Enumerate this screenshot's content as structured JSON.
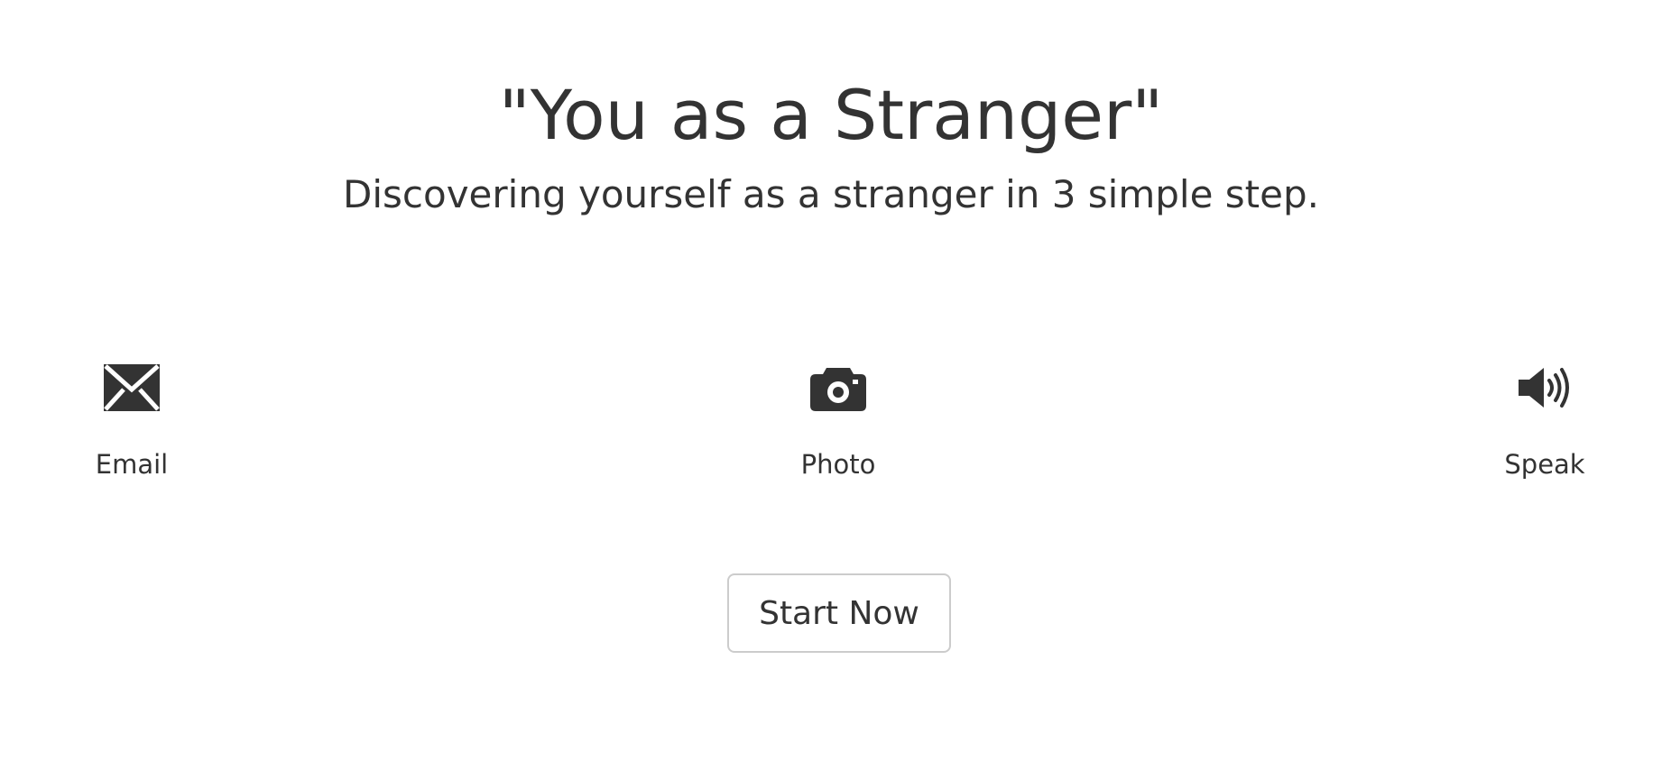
{
  "header": {
    "title": "\"You as a Stranger\"",
    "subtitle": "Discovering yourself as a stranger in 3 simple step."
  },
  "steps": [
    {
      "label": "Email",
      "icon": "envelope-icon"
    },
    {
      "label": "Photo",
      "icon": "camera-icon"
    },
    {
      "label": "Speak",
      "icon": "speaker-icon"
    }
  ],
  "cta": {
    "label": "Start Now"
  },
  "colors": {
    "text": "#333333",
    "button_border": "#cccccc",
    "background": "#ffffff"
  }
}
